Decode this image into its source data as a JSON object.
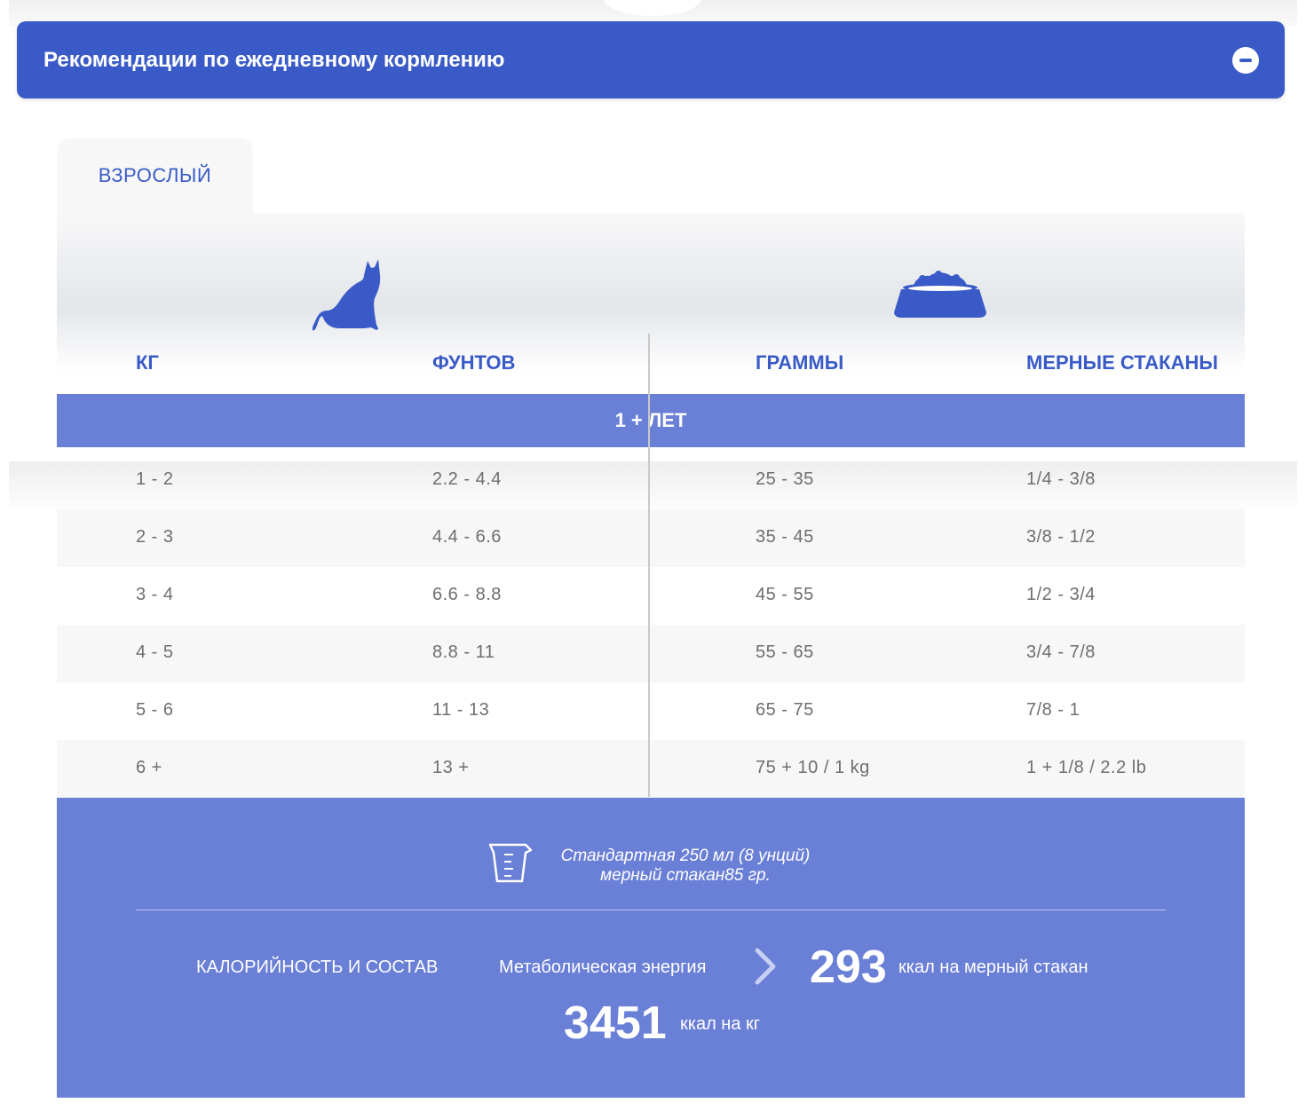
{
  "accordion": {
    "title": "Рекомендации по ежедневному кормлению",
    "collapse_icon": "minus-circle-icon",
    "accent_color": "#3a5bc7"
  },
  "tabs": [
    {
      "label": "ВЗРОСЛЫЙ",
      "active": true
    }
  ],
  "table": {
    "icons": {
      "pet": "cat-icon",
      "food": "food-bowl-icon"
    },
    "headers": {
      "kg": "КГ",
      "lbs": "ФУНТОВ",
      "grams": "ГРАММЫ",
      "cups": "МЕРНЫЕ СТАКАНЫ"
    },
    "age_group": "1 + ЛЕТ",
    "rows": [
      {
        "kg": "1 - 2",
        "lbs": "2.2 - 4.4",
        "grams": "25 - 35",
        "cups": "1/4 - 3/8"
      },
      {
        "kg": "2 - 3",
        "lbs": "4.4 - 6.6",
        "grams": "35 - 45",
        "cups": "3/8 - 1/2"
      },
      {
        "kg": "3 - 4",
        "lbs": "6.6 - 8.8",
        "grams": "45 - 55",
        "cups": "1/2 - 3/4"
      },
      {
        "kg": "4 - 5",
        "lbs": "8.8 - 11",
        "grams": "55 - 65",
        "cups": "3/4 - 7/8"
      },
      {
        "kg": "5 - 6",
        "lbs": "11 - 13",
        "grams": "65 - 75",
        "cups": "7/8 - 1"
      },
      {
        "kg": "6 +",
        "lbs": "13 +",
        "grams": "75 + 10 / 1 kg",
        "cups": "1 + 1/8 / 2.2 lb"
      }
    ]
  },
  "footer": {
    "cup_icon": "measuring-cup-icon",
    "cup_note_line1": "Стандартная 250 мл (8 унций)",
    "cup_note_line2": "мерный стакан85 гр.",
    "calorie_heading": "КАЛОРИЙНОСТЬ И СОСТАВ",
    "metabolic_label": "Метаболическая энергия",
    "arrow_icon": "chevron-right-icon",
    "kcal_per_cup": "293",
    "kcal_per_cup_unit": "ккал на мерный стакан",
    "kcal_per_kg": "3451",
    "kcal_per_kg_unit": "ккал на кг",
    "band_color": "#6a7fd6"
  }
}
